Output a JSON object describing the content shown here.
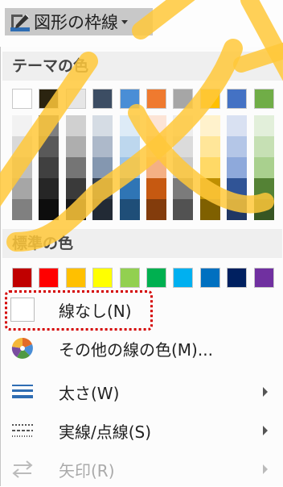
{
  "ribbon": {
    "button_label": "図形の枠線",
    "accent": "#2f6db3"
  },
  "menu": {
    "theme_colors_header": "テーマの色",
    "standard_colors_header": "標準の色",
    "theme_top_row": [
      "#ffffff",
      "#2b2410",
      "#e6e6e6",
      "#3c4d63",
      "#4a8ed6",
      "#ef7a2f",
      "#a6a6a6",
      "#ffc000",
      "#4472c4",
      "#70ad47"
    ],
    "theme_columns": [
      [
        "#f2f2f2",
        "#d9d9d9",
        "#bfbfbf",
        "#a6a6a6",
        "#808080"
      ],
      [
        "#7f7f7f",
        "#595959",
        "#404040",
        "#262626",
        "#0d0d0d"
      ],
      [
        "#d0d0d0",
        "#aeaeae",
        "#757575",
        "#3a3a3a",
        "#171717"
      ],
      [
        "#d5dce4",
        "#adb9ca",
        "#8497b0",
        "#333f4f",
        "#222a35"
      ],
      [
        "#ddebf7",
        "#bdd7ee",
        "#9bc2e6",
        "#2f75b5",
        "#1f4e78"
      ],
      [
        "#fce4d6",
        "#f8cbad",
        "#f4b084",
        "#c65911",
        "#833c0c"
      ],
      [
        "#ededed",
        "#dbdbdb",
        "#c9c9c9",
        "#7b7b7b",
        "#525252"
      ],
      [
        "#fff2cc",
        "#ffe699",
        "#ffd966",
        "#bf8f00",
        "#7f6000"
      ],
      [
        "#d9e1f2",
        "#b4c6e7",
        "#8ea9db",
        "#305496",
        "#203764"
      ],
      [
        "#e2efda",
        "#c6e0b4",
        "#a9d08e",
        "#548235",
        "#375623"
      ]
    ],
    "standard_row": [
      "#c00000",
      "#ff0000",
      "#ffc000",
      "#ffff00",
      "#92d050",
      "#00b050",
      "#00b0f0",
      "#0070c0",
      "#002060",
      "#7030a0"
    ],
    "items": [
      {
        "label": "線なし(N)"
      },
      {
        "label": "その他の線の色(M)..."
      },
      {
        "label": "太さ(W)"
      },
      {
        "label": "実線/点線(S)"
      },
      {
        "label": "矢印(R)"
      }
    ],
    "highlight_color": "#d40000"
  },
  "overlay_color": "#ffc83a"
}
